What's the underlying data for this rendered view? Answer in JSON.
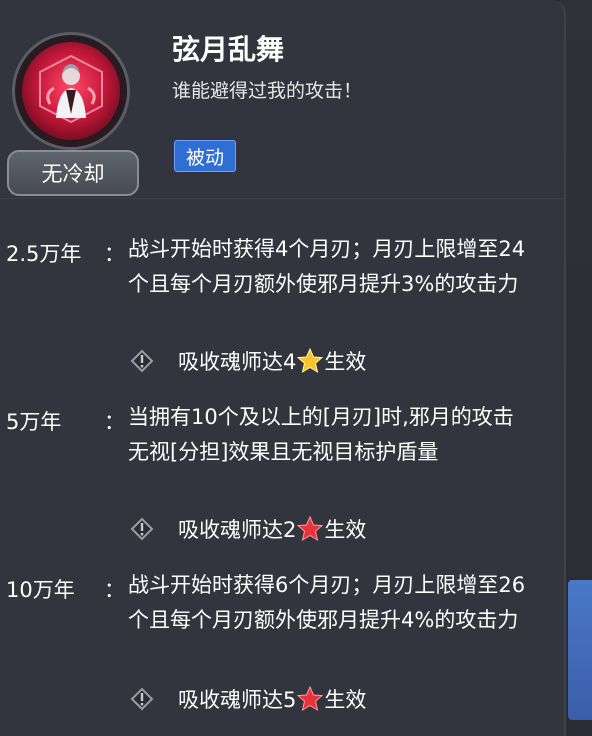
{
  "header": {
    "skill_name": "弦月乱舞",
    "quote": "谁能避得过我的攻击！",
    "type_tag": "被动",
    "cooldown": "无冷却"
  },
  "tiers": [
    {
      "year": "2.5万年",
      "colon": "：",
      "desc": "战斗开始时获得4个月刃；月刃上限增至24个且每个月刃额外使邪月提升3%的攻击力",
      "req_prefix": "吸收魂师达4",
      "req_suffix": "生效",
      "star_color": "#f5c52a"
    },
    {
      "year": "5万年",
      "colon": "：",
      "desc": "当拥有10个及以上的[月刃]时,邪月的攻击无视[分担]效果且无视目标护盾量",
      "req_prefix": "吸收魂师达2",
      "req_suffix": "生效",
      "star_color": "#e8323c"
    },
    {
      "year": "10万年",
      "colon": "：",
      "desc": "战斗开始时获得6个月刃；月刃上限增至26个且每个月刃额外使邪月提升4%的攻击力",
      "req_prefix": "吸收魂师达5",
      "req_suffix": "生效",
      "star_color": "#e8323c"
    }
  ],
  "icons": {
    "requirement": "diamond-exclamation-icon",
    "star": "star-icon"
  }
}
